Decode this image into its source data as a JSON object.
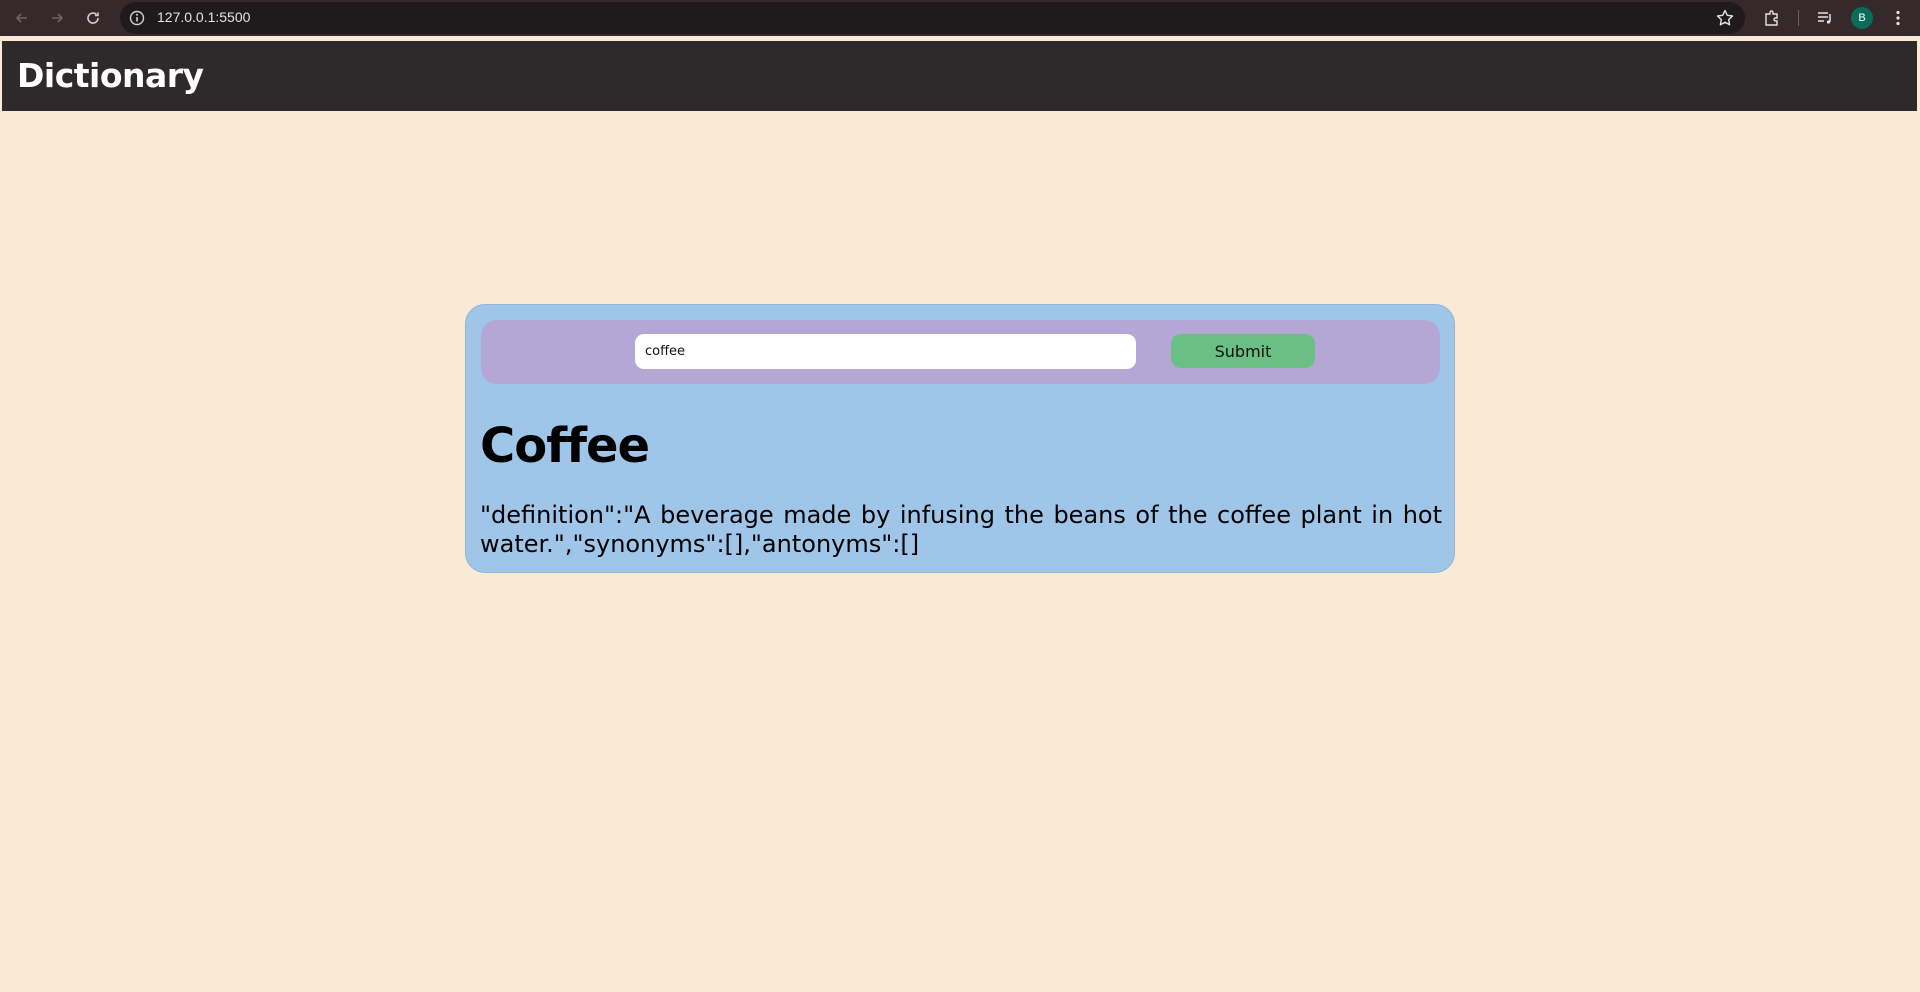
{
  "browser": {
    "url": "127.0.0.1:5500",
    "profile_initial": "B"
  },
  "header": {
    "title": "Dictionary"
  },
  "search": {
    "value": "coffee",
    "submit_label": "Submit"
  },
  "result": {
    "word": "Coffee",
    "definition_text": "\"definition\":\"A beverage made by infusing the beans of the coffee plant in hot water.\",\"synonyms\":[],\"antonyms\":[]"
  },
  "colors": {
    "page_background": "#f9ead6",
    "header_background": "#2e2a2b",
    "card_background": "#9fc5e8",
    "search_bar_background": "#b4a7d6",
    "submit_button": "#6abf85"
  }
}
